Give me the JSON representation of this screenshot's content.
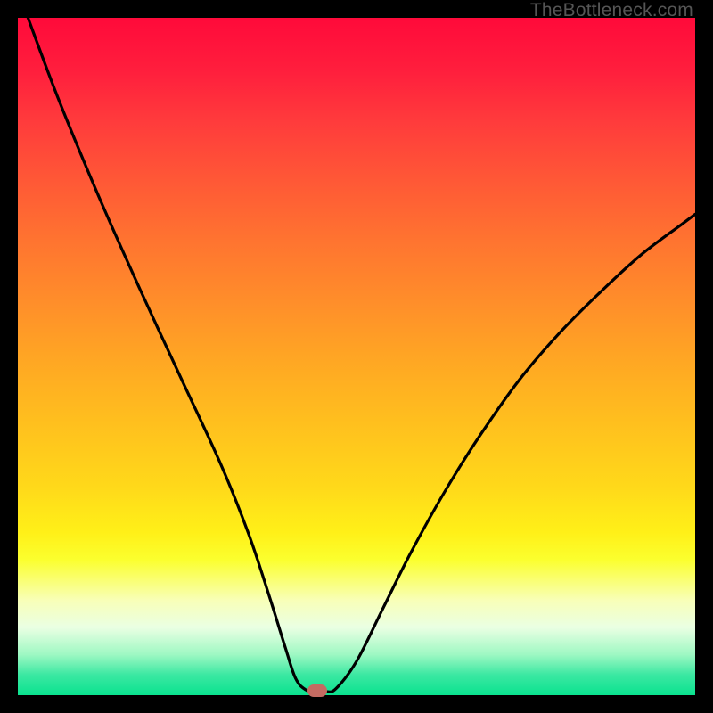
{
  "watermark": "TheBottleneck.com",
  "colors": {
    "background": "#000000",
    "curve": "#000000",
    "dot": "#c46b62"
  },
  "chart_data": {
    "type": "line",
    "title": "",
    "xlabel": "",
    "ylabel": "",
    "xlim": [
      0,
      100
    ],
    "ylim": [
      0,
      100
    ],
    "grid": false,
    "series": [
      {
        "name": "bottleneck-curve",
        "x": [
          1.5,
          6,
          12,
          18,
          24,
          30,
          34,
          37,
          39.5,
          41,
          42.5,
          44,
          45.5,
          47,
          50,
          54,
          58,
          63,
          68,
          74,
          80,
          86,
          92,
          98,
          100
        ],
        "y": [
          100,
          88,
          73.5,
          60,
          47,
          34,
          24,
          15,
          7,
          2.5,
          0.8,
          0.5,
          0.5,
          1,
          5,
          13,
          21,
          30,
          38,
          46.5,
          53.5,
          59.5,
          65,
          69.5,
          71
        ]
      }
    ],
    "marker": {
      "x_pct": 44.2,
      "y_pct": 0.6
    },
    "gradient_stops": [
      {
        "pct": 0,
        "color": "#ff0a3a"
      },
      {
        "pct": 24,
        "color": "#ff5836"
      },
      {
        "pct": 51,
        "color": "#ffa823"
      },
      {
        "pct": 76,
        "color": "#fff018"
      },
      {
        "pct": 90,
        "color": "#eaffe3"
      },
      {
        "pct": 100,
        "color": "#0ae28f"
      }
    ]
  }
}
